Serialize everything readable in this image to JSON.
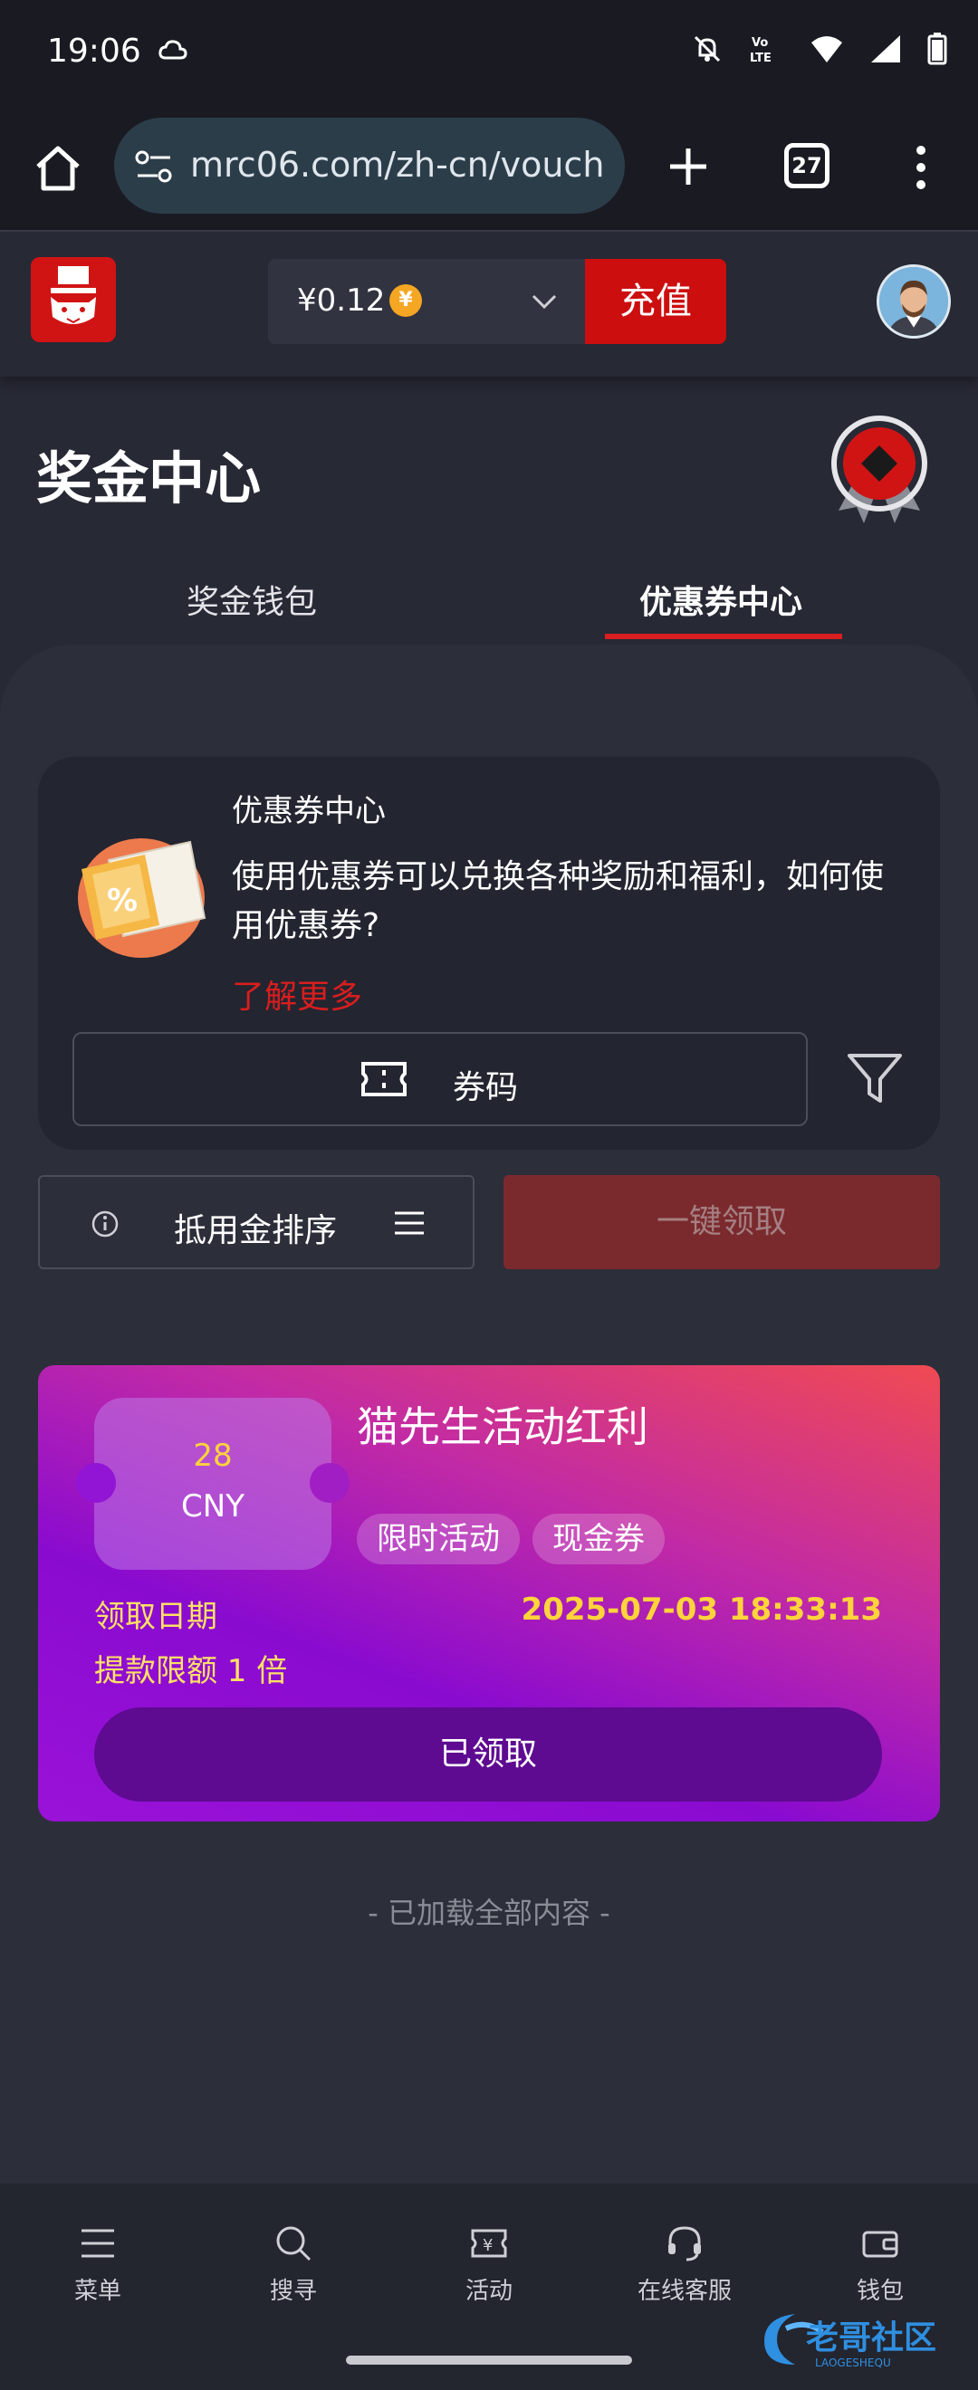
{
  "status_bar": {
    "time": "19:06"
  },
  "browser": {
    "url": "mrc06.com/zh-cn/vouch",
    "tab_count": "27"
  },
  "header": {
    "balance": "¥0.12",
    "coin_symbol": "¥",
    "recharge_label": "充值"
  },
  "page": {
    "title": "奖金中心",
    "tabs": [
      {
        "label": "奖金钱包",
        "active": false
      },
      {
        "label": "优惠券中心",
        "active": true
      }
    ]
  },
  "info_card": {
    "title": "优惠券中心",
    "description": "使用优惠券可以兑换各种奖励和福利，如何使用优惠券?",
    "learn_more": "了解更多",
    "code_button": "券码"
  },
  "actions": {
    "sort_label": "抵用金排序",
    "claim_all_label": "一键领取"
  },
  "reward_card": {
    "amount": "28",
    "currency": "CNY",
    "title": "猫先生活动红利",
    "tags": [
      "限时活动",
      "现金券"
    ],
    "date_label": "领取日期",
    "date_value": "2025-07-03 18:33:13",
    "limit_label": "提款限额 1 倍",
    "status_button": "已领取"
  },
  "footer_text": "- 已加载全部内容 -",
  "bottom_nav": [
    {
      "label": "菜单",
      "icon": "menu-icon"
    },
    {
      "label": "搜寻",
      "icon": "search-icon"
    },
    {
      "label": "活动",
      "icon": "ticket-icon"
    },
    {
      "label": "在线客服",
      "icon": "headset-icon"
    },
    {
      "label": "钱包",
      "icon": "wallet-icon"
    }
  ],
  "colors": {
    "accent": "#d81e1e",
    "background": "#272935",
    "gold": "#ffd43b"
  }
}
